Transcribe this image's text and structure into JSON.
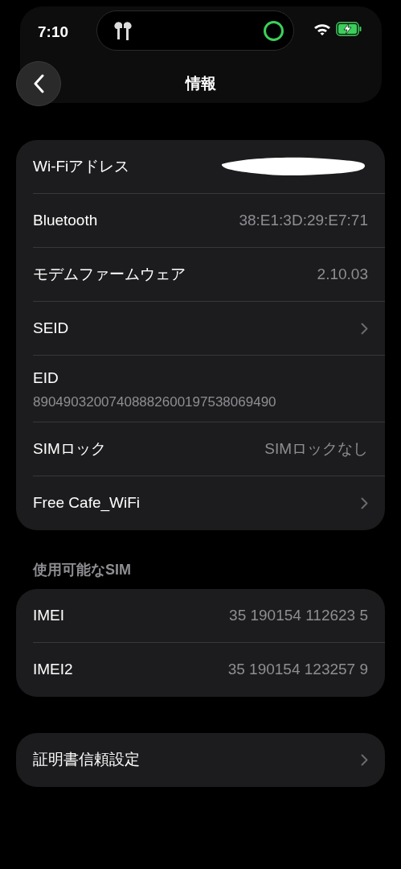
{
  "status_bar": {
    "time": "7:10"
  },
  "nav": {
    "title": "情報"
  },
  "groups": [
    {
      "rows": [
        {
          "kind": "redacted",
          "label": "Wi-Fiアドレス"
        },
        {
          "kind": "value",
          "label": "Bluetooth",
          "value": "38:E1:3D:29:E7:71"
        },
        {
          "kind": "value",
          "label": "モデムファームウェア",
          "value": "2.10.03"
        },
        {
          "kind": "chevron",
          "label": "SEID"
        },
        {
          "kind": "stacked",
          "label": "EID",
          "value": "89049032007408882600197538069490"
        },
        {
          "kind": "value",
          "label": "SIMロック",
          "value": "SIMロックなし"
        },
        {
          "kind": "chevron",
          "label": "Free Cafe_WiFi"
        }
      ]
    },
    {
      "header": "使用可能なSIM",
      "rows": [
        {
          "kind": "value",
          "label": "IMEI",
          "value": "35 190154 112623 5"
        },
        {
          "kind": "value",
          "label": "IMEI2",
          "value": "35 190154 123257 9"
        }
      ]
    },
    {
      "rows": [
        {
          "kind": "chevron",
          "label": "証明書信頼設定"
        }
      ]
    }
  ]
}
